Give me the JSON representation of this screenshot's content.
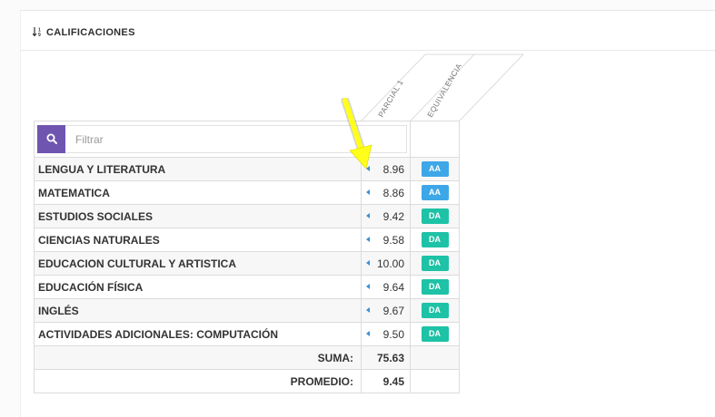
{
  "section": {
    "title": "CALIFICACIONES",
    "icon": "sort-numeric-icon"
  },
  "columns": {
    "partial": "PARCIAL 1",
    "equivalence": "EQUIVALENCIA"
  },
  "filter": {
    "placeholder": "Filtrar",
    "icon": "search-icon"
  },
  "colors": {
    "accent": "#6f55b0",
    "aa_badge": "#3ea7e8",
    "da_badge": "#1ec2a6",
    "caret": "#3a8fd6",
    "arrow": "#ffff1a"
  },
  "subjects": [
    {
      "name": "LENGUA Y LITERATURA",
      "grade": "8.96",
      "equivalence": "AA",
      "badge_color": "#3ea7e8"
    },
    {
      "name": "MATEMATICA",
      "grade": "8.86",
      "equivalence": "AA",
      "badge_color": "#3ea7e8"
    },
    {
      "name": "ESTUDIOS SOCIALES",
      "grade": "9.42",
      "equivalence": "DA",
      "badge_color": "#1ec2a6"
    },
    {
      "name": "CIENCIAS NATURALES",
      "grade": "9.58",
      "equivalence": "DA",
      "badge_color": "#1ec2a6"
    },
    {
      "name": "EDUCACION CULTURAL Y ARTISTICA",
      "grade": "10.00",
      "equivalence": "DA",
      "badge_color": "#1ec2a6"
    },
    {
      "name": "EDUCACIÓN FÍSICA",
      "grade": "9.64",
      "equivalence": "DA",
      "badge_color": "#1ec2a6"
    },
    {
      "name": "INGLÉS",
      "grade": "9.67",
      "equivalence": "DA",
      "badge_color": "#1ec2a6"
    },
    {
      "name": "ACTIVIDADES ADICIONALES: COMPUTACIÓN",
      "grade": "9.50",
      "equivalence": "DA",
      "badge_color": "#1ec2a6"
    }
  ],
  "summary": {
    "sum_label": "SUMA:",
    "sum_value": "75.63",
    "avg_label": "PROMEDIO:",
    "avg_value": "9.45"
  }
}
